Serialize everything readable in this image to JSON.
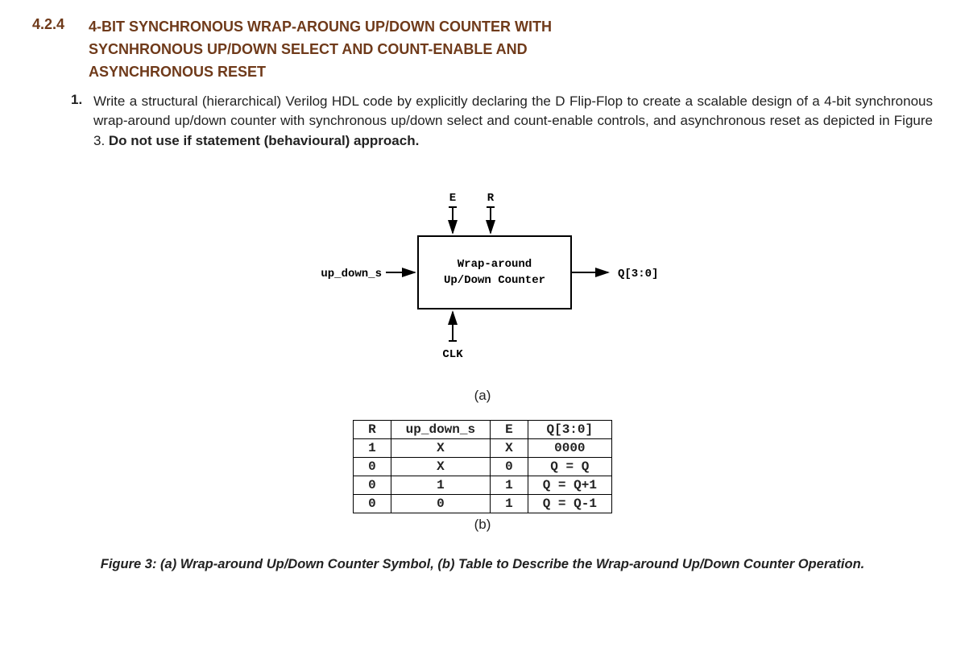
{
  "section": {
    "number": "4.2.4",
    "title_line1": "4-BIT SYNCHRONOUS WRAP-AROUNG UP/DOWN COUNTER WITH",
    "title_line2": "SYCNHRONOUS UP/DOWN SELECT AND COUNT-ENABLE AND",
    "title_line3": "ASYNCHRONOUS RESET"
  },
  "item": {
    "number": "1.",
    "text_part1": "Write a structural (hierarchical) Verilog HDL code by explicitly declaring the D Flip-Flop to create a scalable design of a 4-bit synchronous wrap-around up/down counter with synchronous up/down select and count-enable controls, and asynchronous reset as depicted in Figure 3. ",
    "text_bold": "Do not use if statement (behavioural) approach."
  },
  "diagram": {
    "top_label_e": "E",
    "top_label_r": "R",
    "left_label": "up_down_s",
    "box_line1": "Wrap-around",
    "box_line2": "Up/Down Counter",
    "bottom_label": "CLK",
    "right_label": "Q[3:0]",
    "sublabel": "(a)"
  },
  "table": {
    "headers": [
      "R",
      "up_down_s",
      "E",
      "Q[3:0]"
    ],
    "rows": [
      [
        "1",
        "X",
        "X",
        "0000"
      ],
      [
        "0",
        "X",
        "0",
        "Q = Q"
      ],
      [
        "0",
        "1",
        "1",
        "Q = Q+1"
      ],
      [
        "0",
        "0",
        "1",
        "Q = Q-1"
      ]
    ],
    "sublabel": "(b)"
  },
  "caption": "Figure 3: (a) Wrap-around Up/Down Counter Symbol, (b) Table to Describe the Wrap-around Up/Down Counter Operation."
}
